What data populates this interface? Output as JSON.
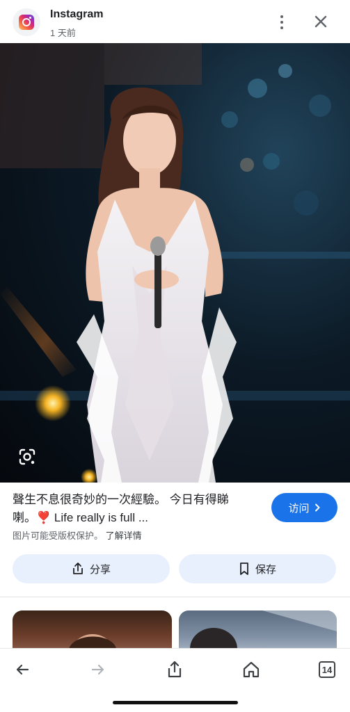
{
  "header": {
    "source_name": "Instagram",
    "time": "1 天前",
    "icons": {
      "more": "more-vert-icon",
      "close": "close-icon",
      "app": "instagram-logo-icon"
    }
  },
  "image": {
    "lens_icon": "google-lens-icon"
  },
  "caption": {
    "text": "聲生不息很奇妙的一次經驗。 今日有得睇喇。❣️ Life really is full ...",
    "copyright_text": "图片可能受版权保护。",
    "learn_more": "了解详情"
  },
  "visit_button": {
    "label": "访问",
    "icon": "chevron-right-icon"
  },
  "actions": {
    "share_label": "分享",
    "save_label": "保存",
    "share_icon": "share-icon",
    "save_icon": "bookmark-icon"
  },
  "bottom_nav": {
    "tab_count": "14",
    "icons": [
      "back-arrow-icon",
      "forward-arrow-icon",
      "share-icon",
      "home-icon",
      "tabs-icon"
    ]
  },
  "colors": {
    "accent": "#1a73e8",
    "action_bg": "#e8f0fe"
  }
}
